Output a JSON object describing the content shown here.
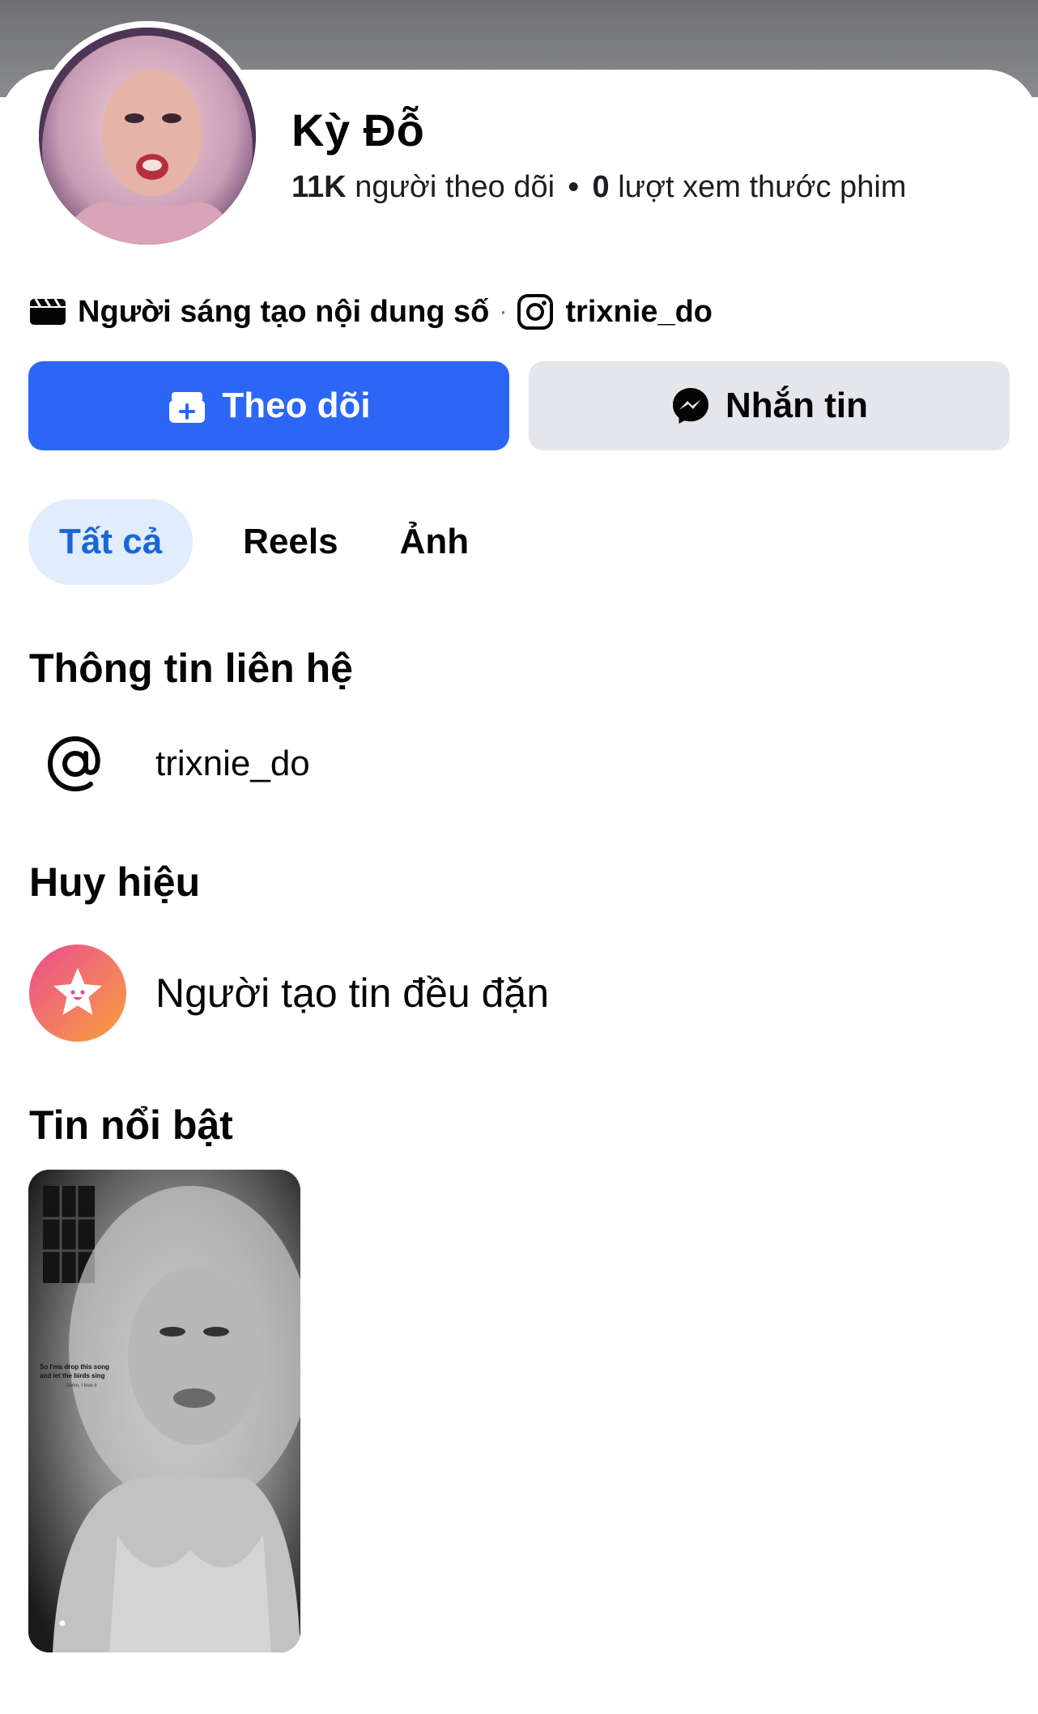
{
  "profile": {
    "name": "Kỳ Đỗ",
    "followers_count": "11K",
    "followers_label": "người theo dõi",
    "separator": "•",
    "reel_views_count": "0",
    "reel_views_label": "lượt xem thước phim",
    "category": "Người sáng tạo nội dung số",
    "meta_separator": "·",
    "instagram_handle": "trixnie_do"
  },
  "actions": {
    "follow_label": "Theo dõi",
    "message_label": "Nhắn tin",
    "follow_color": "#2b66f6"
  },
  "tabs": [
    {
      "label": "Tất cả",
      "active": true
    },
    {
      "label": "Reels",
      "active": false
    },
    {
      "label": "Ảnh",
      "active": false
    }
  ],
  "contact": {
    "title": "Thông tin liên hệ",
    "icon": "at-sign-icon",
    "value": "trixnie_do"
  },
  "badges": {
    "title": "Huy hiệu",
    "icon": "star-face-icon",
    "label": "Người tạo tin đều đặn"
  },
  "highlights": {
    "title": "Tin nổi bật",
    "story_caption_1": "So I'ma drop this song",
    "story_caption_2": "and let the birds sing",
    "story_caption_3": "Damn, I love it"
  }
}
